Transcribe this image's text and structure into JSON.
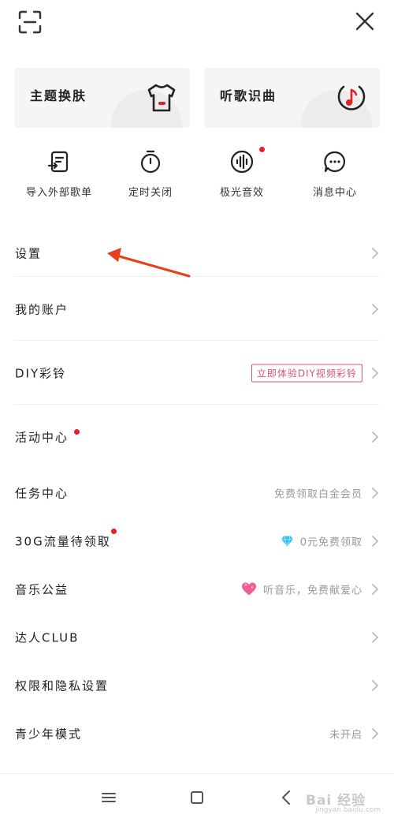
{
  "colors": {
    "accent_red": "#e32126",
    "badge_pink": "#e0506f",
    "card_bg": "#f5f5f7",
    "muted_text": "#999999"
  },
  "top_bar": {
    "scan_icon": "scan-icon",
    "close_icon": "close-icon"
  },
  "cards": [
    {
      "label": "主题换肤",
      "icon": "tshirt-icon"
    },
    {
      "label": "听歌识曲",
      "icon": "music-recognize-icon"
    }
  ],
  "quick_actions": [
    {
      "label": "导入外部歌单",
      "icon": "import-playlist-icon",
      "dot": false
    },
    {
      "label": "定时关闭",
      "icon": "timer-icon",
      "dot": false
    },
    {
      "label": "极光音效",
      "icon": "sound-effect-icon",
      "dot": true
    },
    {
      "label": "消息中心",
      "icon": "message-icon",
      "dot": false
    }
  ],
  "menu": {
    "settings": {
      "label": "设置"
    },
    "account": {
      "label": "我的账户"
    },
    "diy_ringtone": {
      "label": "DIY彩铃",
      "badge": "立即体验DIY视频彩铃"
    },
    "activity": {
      "label": "活动中心"
    },
    "tasks": {
      "label": "任务中心",
      "right": "免费领取白金会员"
    },
    "traffic": {
      "label": "30G流量待领取",
      "right": "0元免费领取"
    },
    "charity": {
      "label": "音乐公益",
      "right": "听音乐，免费献爱心"
    },
    "club": {
      "label": "达人CLUB"
    },
    "privacy": {
      "label": "权限和隐私设置"
    },
    "teen": {
      "label": "青少年模式",
      "right": "未开启"
    }
  },
  "watermark": {
    "text": "Bai 经验",
    "sub": "jingyan.baidu.com"
  }
}
